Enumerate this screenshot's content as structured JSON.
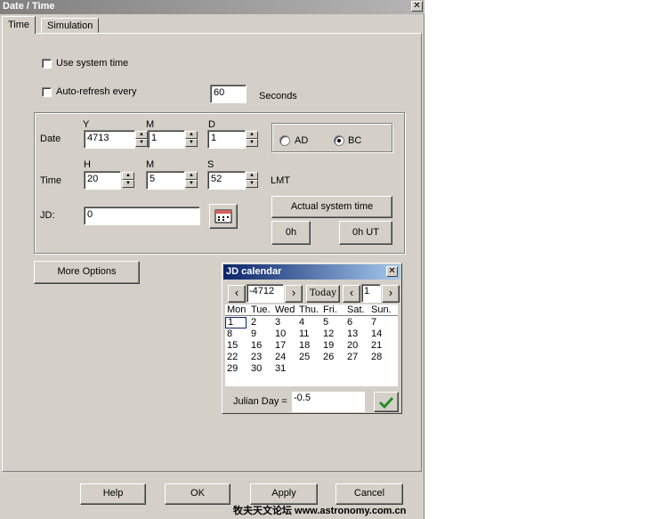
{
  "window": {
    "title": "Date / Time"
  },
  "tabs": [
    {
      "label": "Time"
    },
    {
      "label": "Simulation"
    }
  ],
  "time_tab": {
    "use_system_time": {
      "label": "Use system time",
      "checked": false
    },
    "auto_refresh": {
      "label": "Auto-refresh every",
      "checked": false,
      "value": "60",
      "unit": "Seconds"
    },
    "date": {
      "label": "Date",
      "y_label": "Y",
      "y_value": "4713",
      "m_label": "M",
      "m_value": "1",
      "d_label": "D",
      "d_value": "1"
    },
    "era": {
      "ad_label": "AD",
      "bc_label": "BC",
      "selected": "BC"
    },
    "time": {
      "label": "Time",
      "h_label": "H",
      "h_value": "20",
      "m_label": "M",
      "m_value": "5",
      "s_label": "S",
      "s_value": "52",
      "zone": "LMT"
    },
    "jd": {
      "label": "JD:",
      "value": "0"
    },
    "buttons": {
      "actual_system_time": "Actual system time",
      "zero_h": "0h",
      "zero_h_ut": "0h UT",
      "more_options": "More Options"
    }
  },
  "jd_calendar": {
    "title": "JD calendar",
    "year": "-4712",
    "today_label": "Today",
    "month": "1",
    "weekdays": [
      "Mon",
      "Tue.",
      "Wed",
      "Thu.",
      "Fri.",
      "Sat.",
      "Sun."
    ],
    "weeks": [
      [
        "1",
        "2",
        "3",
        "4",
        "5",
        "6",
        "7"
      ],
      [
        "8",
        "9",
        "10",
        "11",
        "12",
        "13",
        "14"
      ],
      [
        "15",
        "16",
        "17",
        "18",
        "19",
        "20",
        "21"
      ],
      [
        "22",
        "23",
        "24",
        "25",
        "26",
        "27",
        "28"
      ],
      [
        "29",
        "30",
        "31",
        "",
        "",
        "",
        ""
      ]
    ],
    "selected_day": "1",
    "julian_day_label": "Julian Day =",
    "julian_day_value": "-0.5"
  },
  "footer_buttons": {
    "help": "Help",
    "ok": "OK",
    "apply": "Apply",
    "cancel": "Cancel"
  },
  "watermark": "牧夫天文论坛 www.astronomy.com.cn"
}
